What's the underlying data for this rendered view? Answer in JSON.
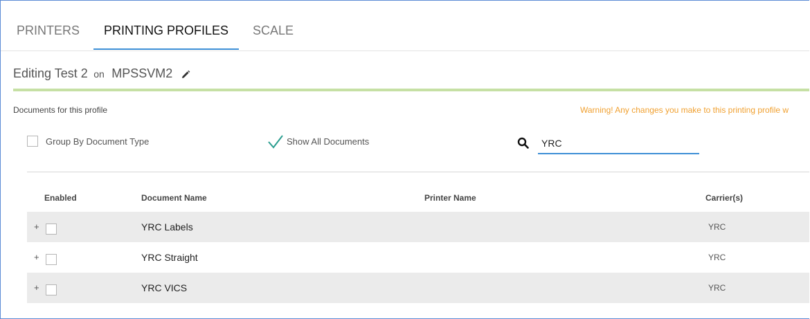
{
  "tabs": [
    {
      "label": "PRINTERS",
      "active": false
    },
    {
      "label": "PRINTING PROFILES",
      "active": true
    },
    {
      "label": "SCALE",
      "active": false
    }
  ],
  "header": {
    "editing_label": "Editing Test 2",
    "on_label": "on",
    "machine_name": "MPSSVM2",
    "edit_icon": "pencil-icon"
  },
  "section": {
    "documents_label": "Documents for this profile",
    "warning": "Warning! Any changes you make to this printing profile w",
    "warning_color": "#f0a030",
    "progress_color": "#c6e0a4"
  },
  "options": {
    "group_by_label": "Group By Document Type",
    "group_by_checked": false,
    "show_all_label": "Show All Documents",
    "show_all_checked": true
  },
  "search": {
    "value": "YRC",
    "icon": "search-icon"
  },
  "table": {
    "headers": {
      "enabled": "Enabled",
      "document_name": "Document Name",
      "printer_name": "Printer Name",
      "carriers": "Carrier(s)"
    },
    "rows": [
      {
        "expand": "+",
        "enabled": false,
        "document_name": "YRC Labels",
        "printer_name": "",
        "carriers": "YRC"
      },
      {
        "expand": "+",
        "enabled": false,
        "document_name": "YRC Straight",
        "printer_name": "",
        "carriers": "YRC"
      },
      {
        "expand": "+",
        "enabled": false,
        "document_name": "YRC VICS",
        "printer_name": "",
        "carriers": "YRC"
      }
    ]
  },
  "colors": {
    "accent": "#3d8fd6",
    "row_shade": "#ebebeb"
  }
}
